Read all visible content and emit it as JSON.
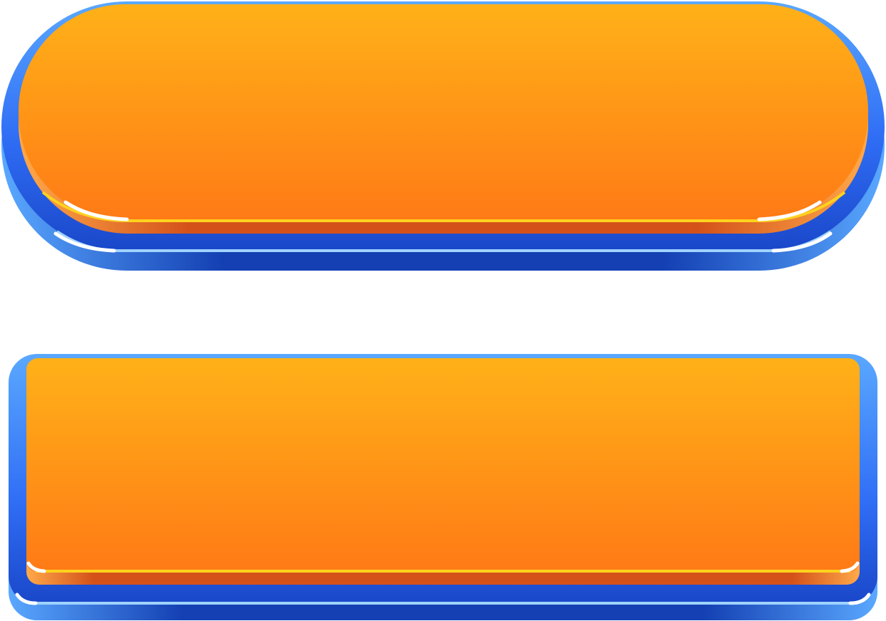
{
  "buttons": [
    {
      "shape": "pill",
      "label": "",
      "colors": {
        "frame_light": "#5fb3ff",
        "frame_mid": "#2f6df5",
        "frame_dark": "#1238a8",
        "face_top": "#ffb118",
        "face_bottom": "#ff7a16",
        "face_edge": "#d4521a",
        "highlight": "#ffd21e"
      }
    },
    {
      "shape": "rounded-rectangle",
      "label": "",
      "colors": {
        "frame_light": "#5fb3ff",
        "frame_mid": "#2f6df5",
        "frame_dark": "#1238a8",
        "face_top": "#ffb118",
        "face_bottom": "#ff7a16",
        "face_edge": "#d4521a",
        "highlight": "#ffd21e"
      }
    }
  ]
}
